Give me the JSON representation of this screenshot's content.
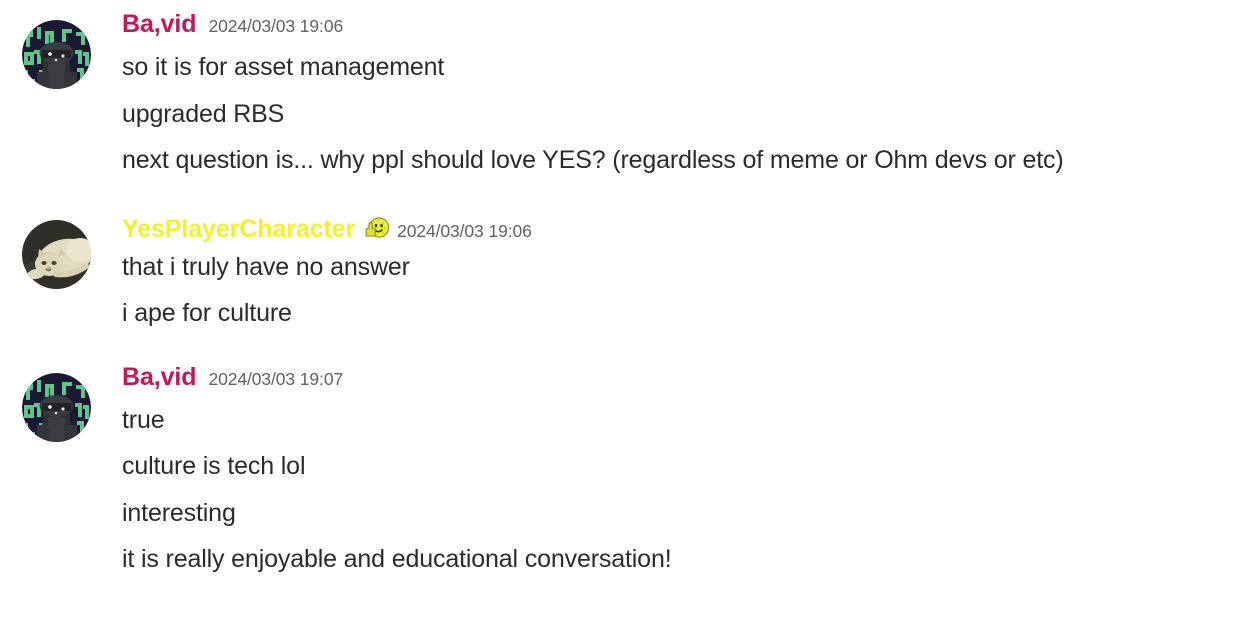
{
  "app": {
    "view": "chat-log",
    "background_color": "#ffffff"
  },
  "colors": {
    "username_crimson": "#c2185b",
    "username_yellow": "#f2f226",
    "timestamp_gray": "#5f6368",
    "body_text": "#2b2b2b",
    "background": "#ffffff"
  },
  "messages": [
    {
      "id": "message-1",
      "author": "Ba,vid",
      "author_color": "#c2185b",
      "timestamp": "2024/03/03 19:06",
      "avatar": "pixel-matrix-avatar",
      "badge": null,
      "lines": [
        "so it is for asset management",
        "upgraded RBS",
        "next question is... why ppl should love YES? (regardless of meme or Ohm devs or etc)"
      ]
    },
    {
      "id": "message-2",
      "author": "YesPlayerCharacter",
      "author_color": "#f2f226",
      "timestamp": "2024/03/03 19:06",
      "avatar": "cat-photo-avatar",
      "badge": "smiley-thumbs-up-icon",
      "lines": [
        "that i truly have no answer",
        "i ape for culture"
      ]
    },
    {
      "id": "message-3",
      "author": "Ba,vid",
      "author_color": "#c2185b",
      "timestamp": "2024/03/03 19:07",
      "avatar": "pixel-matrix-avatar",
      "badge": null,
      "lines": [
        "true",
        "culture is tech lol",
        "interesting",
        "it is really enjoyable and educational conversation!"
      ]
    }
  ]
}
